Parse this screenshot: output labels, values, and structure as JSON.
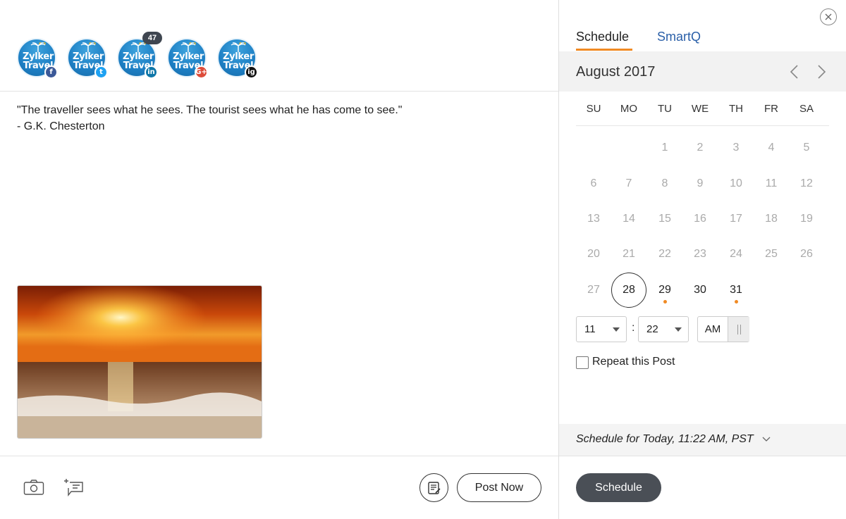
{
  "accounts": [
    {
      "name": "Zylker Travel",
      "logo_line1": "Zylker",
      "logo_line2": "Travel",
      "network": "facebook",
      "network_glyph": "f",
      "network_color": "#3b5998"
    },
    {
      "name": "Zylker Travel",
      "logo_line1": "Zylker",
      "logo_line2": "Travel",
      "network": "twitter",
      "network_glyph": "t",
      "network_color": "#1da1f2",
      "badge": "47"
    },
    {
      "name": "Zylker Travel",
      "logo_line1": "Zylker",
      "logo_line2": "Travel",
      "network": "linkedin",
      "network_glyph": "in",
      "network_color": "#0e76a8"
    },
    {
      "name": "Zylker Travel",
      "logo_line1": "Zylker",
      "logo_line2": "Travel",
      "network": "google-plus",
      "network_glyph": "G+",
      "network_color": "#dd4b39"
    },
    {
      "name": "Zylker Travel",
      "logo_line1": "Zylker",
      "logo_line2": "Travel",
      "network": "instagram",
      "network_glyph": "ig",
      "network_color": "#111111"
    }
  ],
  "post": {
    "quote_line": "\"The traveller sees what he sees. The tourist sees what he has come to see.\"",
    "author_line": "- G.K. Chesterton"
  },
  "toolbar": {
    "camera_icon": "camera-icon",
    "add_text_icon": "add-text-icon",
    "notes_icon": "notes-icon",
    "post_now_label": "Post Now"
  },
  "scheduler": {
    "tabs": [
      {
        "label": "Schedule",
        "active": true
      },
      {
        "label": "SmartQ",
        "active": false
      }
    ],
    "month_label": "August 2017",
    "weekdays": [
      "SU",
      "MO",
      "TU",
      "WE",
      "TH",
      "FR",
      "SA"
    ],
    "weeks": [
      [
        "",
        "",
        "1",
        "2",
        "3",
        "4",
        "5"
      ],
      [
        "6",
        "7",
        "8",
        "9",
        "10",
        "11",
        "12"
      ],
      [
        "13",
        "14",
        "15",
        "16",
        "17",
        "18",
        "19"
      ],
      [
        "20",
        "21",
        "22",
        "23",
        "24",
        "25",
        "26"
      ],
      [
        "27",
        "28",
        "29",
        "30",
        "31",
        "",
        ""
      ]
    ],
    "selected_day": "28",
    "enabled_days": [
      "28",
      "29",
      "30",
      "31"
    ],
    "days_with_posts": [
      "29",
      "31"
    ],
    "hour": "11",
    "minute": "22",
    "time_separator": ":",
    "meridiem": "AM",
    "repeat_label": "Repeat this Post",
    "repeat_checked": false,
    "summary": "Schedule for Today, 11:22 AM, PST",
    "schedule_label": "Schedule"
  },
  "colors": {
    "accent": "#f08a24",
    "link_blue": "#2a5fa8",
    "dark_button": "#4a4f56"
  }
}
